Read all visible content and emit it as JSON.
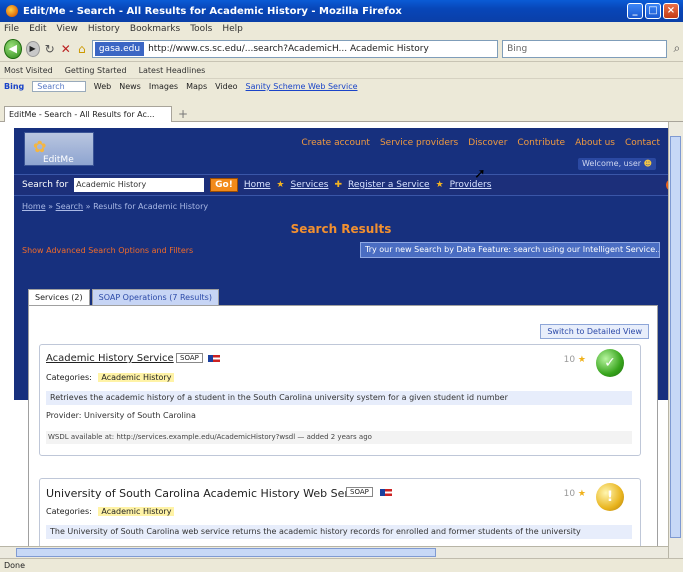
{
  "window": {
    "title": "Edit/Me - Search - All Results for Academic History - Mozilla Firefox",
    "buttons": [
      "_",
      "□",
      "×"
    ]
  },
  "menubar": [
    "File",
    "Edit",
    "View",
    "History",
    "Bookmarks",
    "Tools",
    "Help"
  ],
  "navbar": {
    "url_site": "gasa.edu",
    "url_text": "http://www.cs.sc.edu/...search?AcademicH... Academic History",
    "search_placeholder": "Bing"
  },
  "bookmarks": [
    "Most Visited",
    "Getting Started",
    "Latest Headlines"
  ],
  "addonbar": {
    "brand": "Bing",
    "input": "Search",
    "items": [
      "Web",
      "News",
      "Images",
      "Maps",
      "Video"
    ],
    "link": "Sanity Scheme Web Service"
  },
  "tab": {
    "label": "EditMe - Search - All Results for Ac..."
  },
  "site": {
    "logo_text": "EditMe",
    "top_links": [
      "Create account",
      "Service providers",
      "Discover",
      "Contribute",
      "About us",
      "Contact"
    ],
    "user_label": "Welcome, user",
    "search_label": "Search for",
    "search_value": "Academic History",
    "go_label": "Go!",
    "nav_links": [
      "Home",
      "Services",
      "Register a Service",
      "Providers"
    ],
    "breadcrumb_home": "Home",
    "breadcrumb_search": "Search",
    "breadcrumb_tail": "» Results for Academic History",
    "results_title": "Search Results",
    "advanced": "Show Advanced Search Options and Filters",
    "hint": "Try our new Search by Data Feature: search using our Intelligent Service..."
  },
  "result_tabs": [
    "Services (2)",
    "SOAP Operations (7 Results)"
  ],
  "detail_button": "Switch to Detailed View",
  "results": [
    {
      "name": "Academic History Service",
      "tag": "SOAP",
      "category_label": "Categories:",
      "category": "Academic History",
      "description": "Retrieves the academic history of a student in the South Carolina university system for a given student id number",
      "provider": "Provider: University of South Carolina",
      "footer": "WSDL available at: http://services.example.edu/AcademicHistory?wsdl  —  added 2 years ago",
      "rating": "10",
      "badge": "✓"
    },
    {
      "name": "University of South Carolina Academic History Web Service",
      "tag": "SOAP",
      "category_label": "Categories:",
      "category": "Academic History",
      "description": "The University of South Carolina web service returns the academic history records for enrolled and former students of the university",
      "rating": "10",
      "badge": "!"
    }
  ],
  "statusbar": "Done"
}
